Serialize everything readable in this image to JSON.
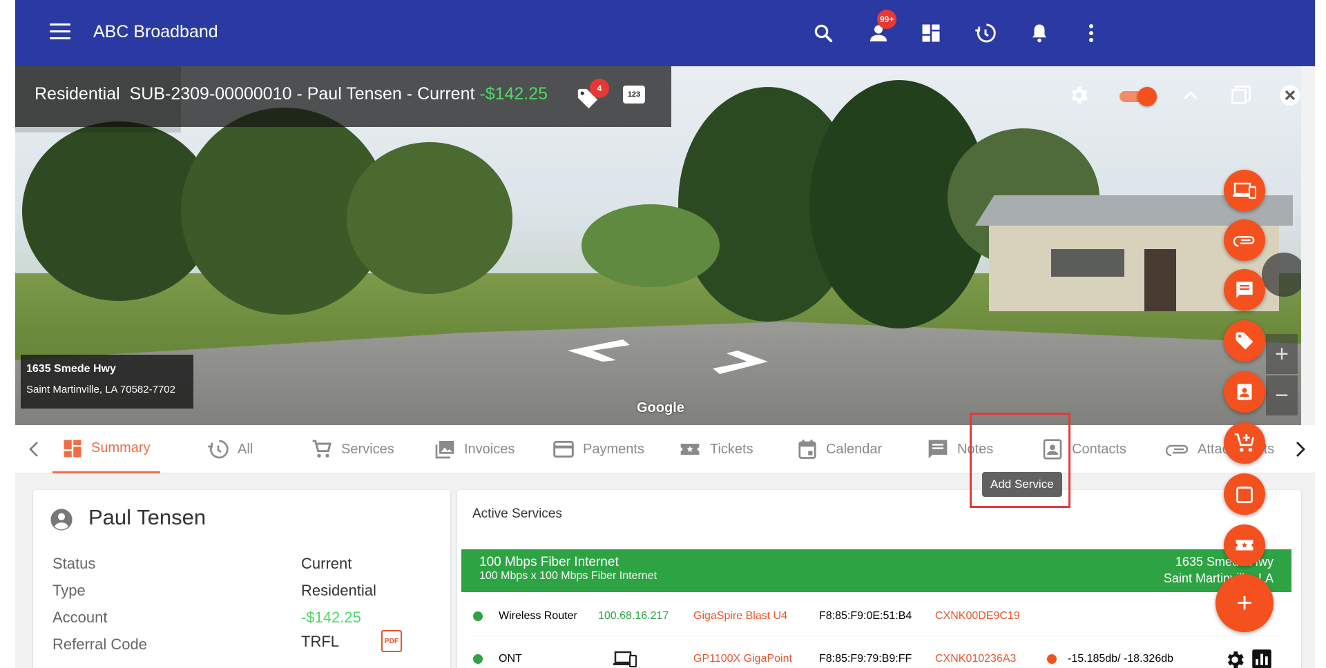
{
  "app": {
    "title": "ABC Broadband",
    "notification_badge": "99+",
    "colors": {
      "appbar": "#2b3aa3",
      "accent": "#f4511e",
      "positive": "#4cd964",
      "service_green": "#2ea344"
    }
  },
  "banner": {
    "account_type": "Residential",
    "subscriber_line": "SUB-2309-00000010 - Paul Tensen - Current",
    "balance": "-$142.25",
    "tag_badge": "4",
    "number_icon": "123",
    "address_line1": "1635 Smede Hwy",
    "address_line2": "Saint Martinville, LA 70582-7702",
    "map_brand": "Google"
  },
  "tabs": [
    {
      "label": "Summary",
      "icon": "dashboard-icon"
    },
    {
      "label": "All",
      "icon": "history-icon"
    },
    {
      "label": "Services",
      "icon": "cart-icon"
    },
    {
      "label": "Invoices",
      "icon": "image-icon"
    },
    {
      "label": "Payments",
      "icon": "card-icon"
    },
    {
      "label": "Tickets",
      "icon": "ticket-icon"
    },
    {
      "label": "Calendar",
      "icon": "calendar-icon"
    },
    {
      "label": "Notes",
      "icon": "note-icon"
    },
    {
      "label": "Contacts",
      "icon": "contact-icon"
    },
    {
      "label": "Attachments",
      "icon": "attachment-icon"
    }
  ],
  "profile": {
    "name": "Paul Tensen",
    "fields": [
      {
        "key": "Status",
        "value": "Current"
      },
      {
        "key": "Type",
        "value": "Residential"
      },
      {
        "key": "Account",
        "value": "-$142.25"
      },
      {
        "key": "Referral Code",
        "value": "TRFL"
      }
    ],
    "pdf_label": "PDF"
  },
  "active_services": {
    "title": "Active Services",
    "service": {
      "name": "100 Mbps Fiber Internet",
      "detail": "100 Mbps x 100 Mbps Fiber Internet",
      "address_line1": "1635 Smede Hwy",
      "address_line2": "Saint Martinville, LA"
    },
    "devices": [
      {
        "name": "Wireless Router",
        "ip": "100.68.16.217",
        "model": "GigaSpire Blast U4",
        "mac": "F8:85:F9:0E:51:B4",
        "serial": "CXNK00DE9C19",
        "signal": ""
      },
      {
        "name": "ONT",
        "ip": "",
        "model": "GP1100X GigaPoint",
        "mac": "F8:85:F9:79:B9:FF",
        "serial": "CXNK010236A3",
        "signal": "-15.185db/ -18.326db"
      }
    ]
  },
  "fab_menu": {
    "tooltip": "Add Service",
    "add_label": "+"
  }
}
